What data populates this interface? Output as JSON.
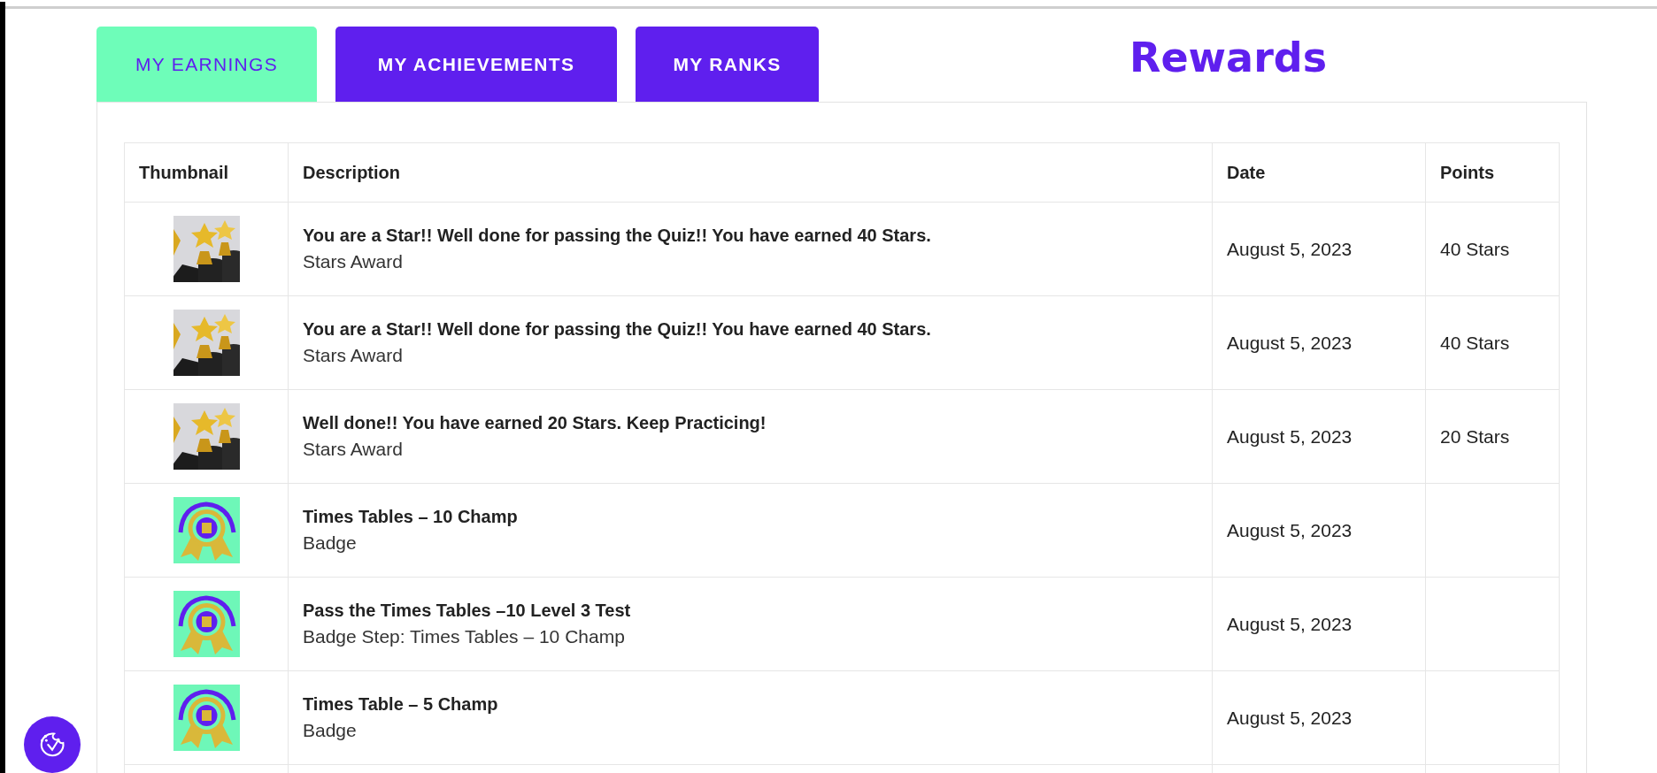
{
  "tabs": [
    {
      "label": "MY EARNINGS",
      "selected": true
    },
    {
      "label": "MY ACHIEVEMENTS",
      "selected": false
    },
    {
      "label": "MY RANKS",
      "selected": false
    }
  ],
  "heading": "Rewards",
  "table": {
    "columns": [
      "Thumbnail",
      "Description",
      "Date",
      "Points"
    ],
    "rows": [
      {
        "thumbnail": {
          "kind": "trophy"
        },
        "title": "You are a Star!! Well done for passing the Quiz!! You have earned 40 Stars.",
        "subtitle": "Stars Award",
        "date": "August 5, 2023",
        "points": "40 Stars"
      },
      {
        "thumbnail": {
          "kind": "trophy"
        },
        "title": "You are a Star!! Well done for passing the Quiz!! You have earned 40 Stars.",
        "subtitle": "Stars Award",
        "date": "August 5, 2023",
        "points": "40 Stars"
      },
      {
        "thumbnail": {
          "kind": "trophy"
        },
        "title": "Well done!! You have earned 20 Stars. Keep Practicing!",
        "subtitle": "Stars Award",
        "date": "August 5, 2023",
        "points": "20 Stars"
      },
      {
        "thumbnail": {
          "kind": "badge"
        },
        "title": "Times Tables – 10 Champ",
        "subtitle": "Badge",
        "date": "August 5, 2023"
      },
      {
        "thumbnail": {
          "kind": "badge"
        },
        "title": "Pass the Times Tables –10 Level 3 Test",
        "subtitle": "Badge Step: Times Tables – 10 Champ",
        "date": "August 5, 2023"
      },
      {
        "thumbnail": {
          "kind": "badge"
        },
        "title": "Times Table – 5 Champ",
        "subtitle": "Badge",
        "date": "August 5, 2023"
      }
    ]
  }
}
